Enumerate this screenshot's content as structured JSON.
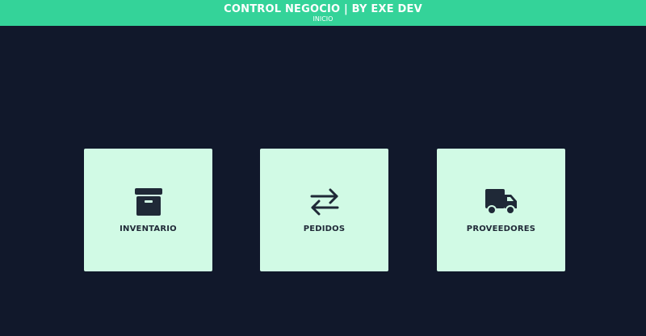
{
  "header": {
    "title": "CONTROL NEGOCIO | BY EXE DEV",
    "subtitle": "INICIO",
    "background": "#34d399"
  },
  "page": {
    "background": "#11182b"
  },
  "cards": [
    {
      "label": "INVENTARIO",
      "icon": "archive-box-icon"
    },
    {
      "label": "PEDIDOS",
      "icon": "arrows-exchange-icon"
    },
    {
      "label": "PROVEEDORES",
      "icon": "truck-icon"
    }
  ],
  "card_style": {
    "background": "#d1fae5",
    "icon_color": "#1f2937"
  }
}
